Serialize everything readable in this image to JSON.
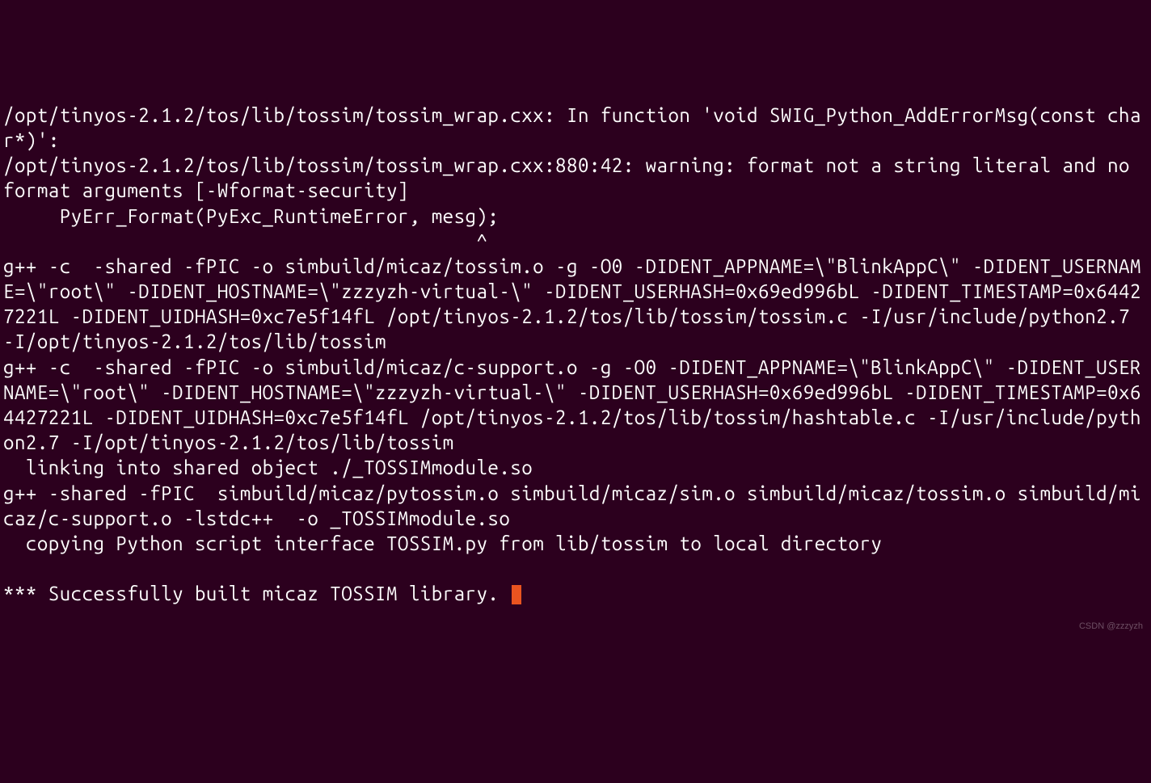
{
  "terminal": {
    "lines": [
      "/opt/tinyos-2.1.2/tos/lib/tossim/tossim_wrap.cxx: In function 'void SWIG_Python_AddErrorMsg(const char*)':",
      "/opt/tinyos-2.1.2/tos/lib/tossim/tossim_wrap.cxx:880:42: warning: format not a string literal and no format arguments [-Wformat-security]",
      "     PyErr_Format(PyExc_RuntimeError, mesg);",
      "                                          ^",
      "g++ -c  -shared -fPIC -o simbuild/micaz/tossim.o -g -O0 -DIDENT_APPNAME=\\\"BlinkAppC\\\" -DIDENT_USERNAME=\\\"root\\\" -DIDENT_HOSTNAME=\\\"zzzyzh-virtual-\\\" -DIDENT_USERHASH=0x69ed996bL -DIDENT_TIMESTAMP=0x64427221L -DIDENT_UIDHASH=0xc7e5f14fL /opt/tinyos-2.1.2/tos/lib/tossim/tossim.c -I/usr/include/python2.7 -I/opt/tinyos-2.1.2/tos/lib/tossim",
      "g++ -c  -shared -fPIC -o simbuild/micaz/c-support.o -g -O0 -DIDENT_APPNAME=\\\"BlinkAppC\\\" -DIDENT_USERNAME=\\\"root\\\" -DIDENT_HOSTNAME=\\\"zzzyzh-virtual-\\\" -DIDENT_USERHASH=0x69ed996bL -DIDENT_TIMESTAMP=0x64427221L -DIDENT_UIDHASH=0xc7e5f14fL /opt/tinyos-2.1.2/tos/lib/tossim/hashtable.c -I/usr/include/python2.7 -I/opt/tinyos-2.1.2/tos/lib/tossim",
      "  linking into shared object ./_TOSSIMmodule.so",
      "g++ -shared -fPIC  simbuild/micaz/pytossim.o simbuild/micaz/sim.o simbuild/micaz/tossim.o simbuild/micaz/c-support.o -lstdc++  -o _TOSSIMmodule.so",
      "  copying Python script interface TOSSIM.py from lib/tossim to local directory",
      "",
      "*** Successfully built micaz TOSSIM library. "
    ]
  },
  "watermark": "CSDN @zzzyzh",
  "colors": {
    "background": "#2c001e",
    "foreground": "#ffffff",
    "cursor": "#e95420"
  }
}
